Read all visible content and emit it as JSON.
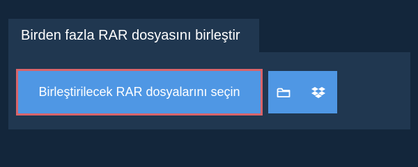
{
  "tab": {
    "label": "Birden fazla RAR dosyasını birleştir"
  },
  "upload": {
    "select_label": "Birleştirilecek RAR dosyalarını seçin",
    "folder_icon": "folder-icon",
    "dropbox_icon": "dropbox-icon"
  },
  "colors": {
    "background": "#13263b",
    "panel": "#203750",
    "button": "#4f97e4",
    "highlight_border": "#d9646a",
    "text": "#ffffff"
  }
}
